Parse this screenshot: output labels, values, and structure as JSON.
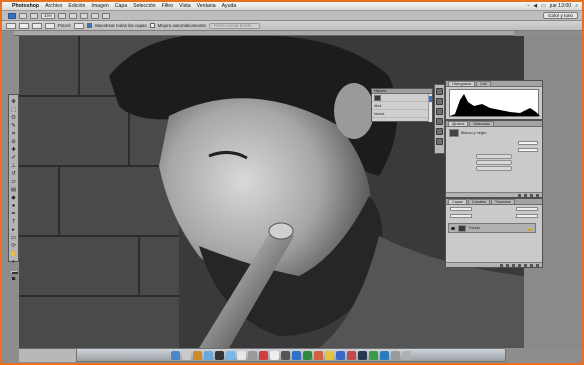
{
  "menubar": {
    "apple": "",
    "items": [
      "Photoshop",
      "Archivo",
      "Edición",
      "Imagen",
      "Capa",
      "Selección",
      "Filtro",
      "Vista",
      "Ventana",
      "Ayuda"
    ],
    "clock": "jue 13:00"
  },
  "appbar": {
    "zoom": "33%",
    "workspace": "Color y tono"
  },
  "options": {
    "width_label": "Pincel:",
    "sample_all_label": "Muestrear todas las capas",
    "auto_enhance_label": "Mejora automáticamente",
    "refine_edge_label": "Perfeccionar borde..."
  },
  "panels": {
    "history_title": "Historia",
    "history_items": [
      "Abrir",
      "Nueva"
    ],
    "histogram_tabs": [
      "Histograma",
      "Info"
    ],
    "adjust_tabs": [
      "Ajustes",
      "Máscaras"
    ],
    "adjust_title": "Blanco y negro",
    "layers_tabs": [
      "Capas",
      "Canales",
      "Trazados"
    ],
    "layer_name": "Fondo"
  },
  "colors": {
    "accent": "#3b72c9",
    "border_orange": "#e8701e"
  }
}
